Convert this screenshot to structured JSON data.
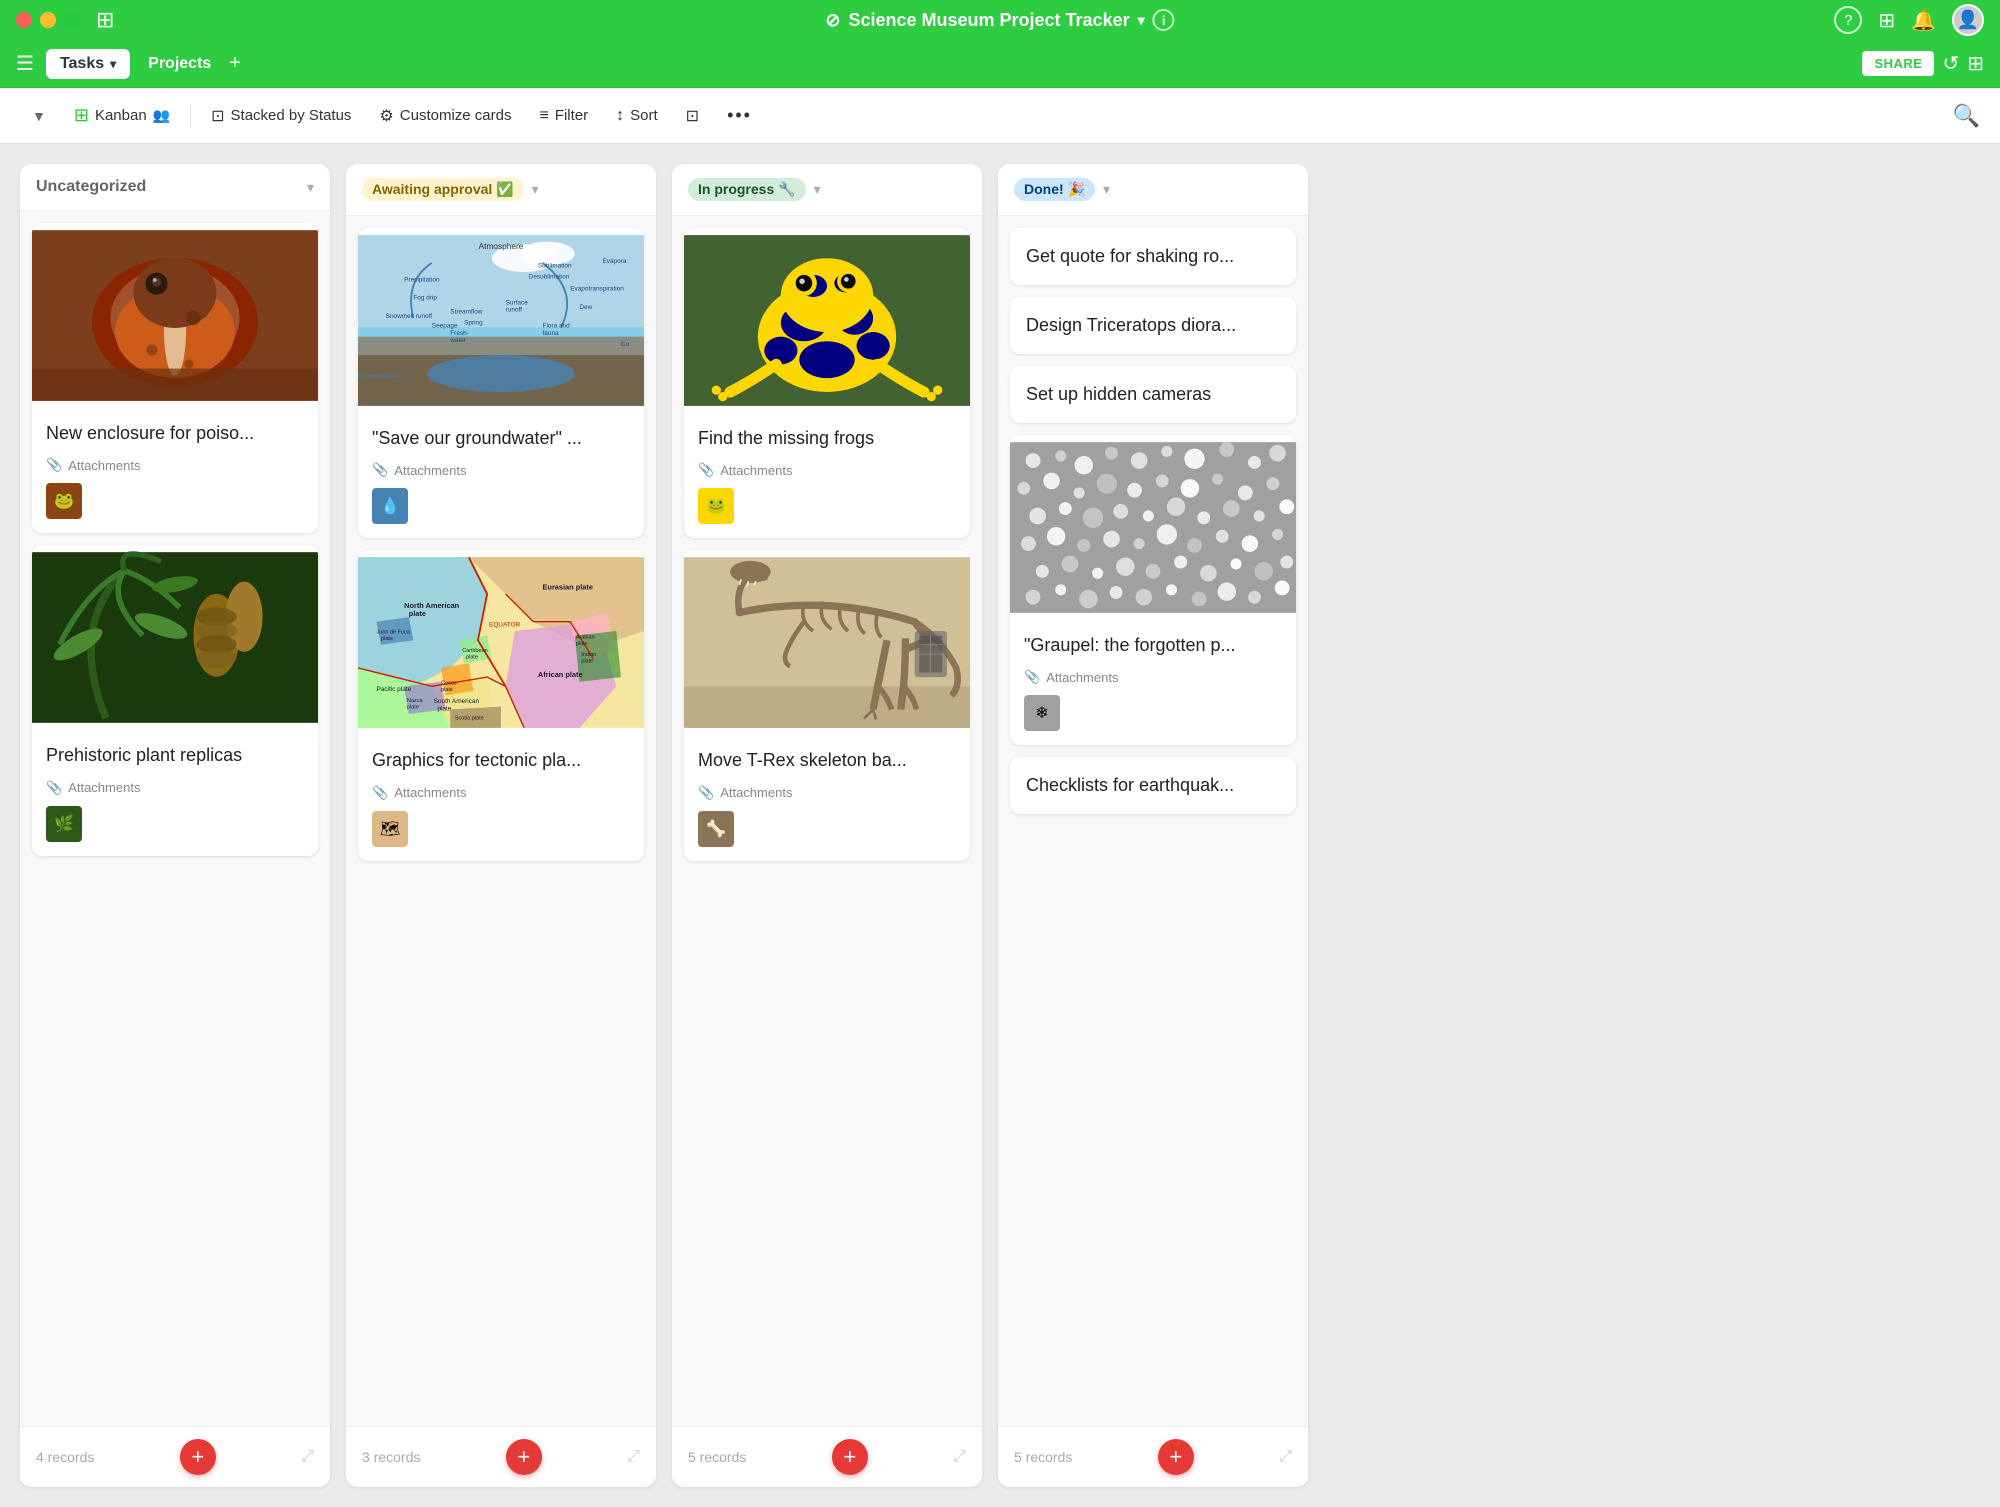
{
  "window": {
    "title": "Science Museum Project Tracker",
    "title_icon": "⊘",
    "info_icon": "ℹ",
    "controls": {
      "close": "close",
      "minimize": "minimize",
      "maximize": "maximize"
    }
  },
  "nav": {
    "tabs": [
      {
        "label": "Tasks",
        "active": true,
        "has_dropdown": true
      },
      {
        "label": "Projects",
        "active": false,
        "has_dropdown": false
      }
    ],
    "add_tab": "+",
    "share_label": "SHARE",
    "icons": [
      "↺",
      "⊞"
    ]
  },
  "toolbar": {
    "view_collapse": "▼",
    "kanban_label": "Kanban",
    "kanban_icon": "⊞",
    "group_icon": "⊡",
    "group_label": "Stacked by Status",
    "customize_icon": "⚙",
    "customize_label": "Customize cards",
    "filter_icon": "≡",
    "filter_label": "Filter",
    "sort_icon": "↕",
    "sort_label": "Sort",
    "external_icon": "⊡",
    "more_icon": "...",
    "search_icon": "🔍"
  },
  "columns": [
    {
      "id": "uncategorized",
      "title": "Uncategorized",
      "status_type": "uncategorized",
      "records_count": "4 records",
      "cards": [
        {
          "id": "card1",
          "has_image": true,
          "image_type": "frog",
          "title": "New enclosure for poiso...",
          "has_attachments": true,
          "attachments_label": "Attachments",
          "thumb_type": "frog-thumb"
        },
        {
          "id": "card2",
          "has_image": true,
          "image_type": "plant",
          "title": "Prehistoric plant replicas",
          "has_attachments": true,
          "attachments_label": "Attachments",
          "thumb_type": "plant-thumb"
        }
      ]
    },
    {
      "id": "awaiting",
      "title": "Awaiting approval ✅",
      "status_type": "awaiting",
      "records_count": "3 records",
      "cards": [
        {
          "id": "card3",
          "has_image": true,
          "image_type": "water",
          "title": "\"Save our groundwater\" ...",
          "has_attachments": true,
          "attachments_label": "Attachments",
          "thumb_type": "water-thumb"
        },
        {
          "id": "card4",
          "has_image": true,
          "image_type": "map",
          "title": "Graphics for tectonic pla...",
          "has_attachments": true,
          "attachments_label": "Attachments",
          "thumb_type": "map-thumb"
        }
      ]
    },
    {
      "id": "inprogress",
      "title": "In progress 🔧",
      "status_type": "inprogress",
      "records_count": "5 records",
      "cards": [
        {
          "id": "card5",
          "has_image": true,
          "image_type": "yellow-frog",
          "title": "Find the missing frogs",
          "has_attachments": true,
          "attachments_label": "Attachments",
          "thumb_type": "yellowfrog-thumb"
        },
        {
          "id": "card6",
          "has_image": true,
          "image_type": "trex",
          "title": "Move T-Rex skeleton ba...",
          "has_attachments": true,
          "attachments_label": "Attachments",
          "thumb_type": "trex-thumb"
        }
      ]
    },
    {
      "id": "done",
      "title": "Done! 🎉",
      "status_type": "done",
      "records_count": "5 records",
      "cards": [
        {
          "id": "card7",
          "has_image": false,
          "title": "Get quote for shaking ro...",
          "has_attachments": false
        },
        {
          "id": "card8",
          "has_image": false,
          "title": "Design Triceratops diora...",
          "has_attachments": false
        },
        {
          "id": "card9",
          "has_image": false,
          "title": "Set up hidden cameras",
          "has_attachments": false
        },
        {
          "id": "card10",
          "has_image": true,
          "image_type": "graupel",
          "title": "\"Graupel: the forgotten p...",
          "has_attachments": true,
          "attachments_label": "Attachments",
          "thumb_type": "graupel-thumb"
        },
        {
          "id": "card11",
          "has_image": false,
          "title": "Checklists for earthquak...",
          "has_attachments": false
        }
      ]
    }
  ]
}
